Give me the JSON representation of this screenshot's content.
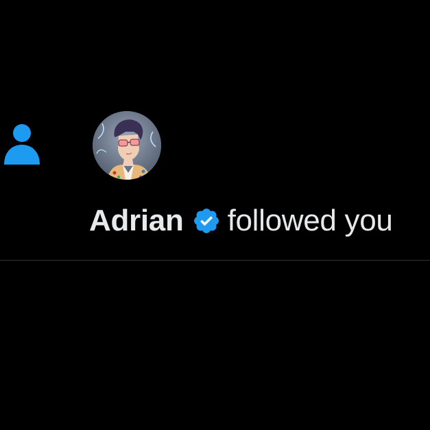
{
  "notification": {
    "type_icon": "person-follow-icon",
    "avatar_icon": "user-avatar-image",
    "verified_icon": "verified-badge-icon",
    "user_name": "Adrian",
    "action_text": "followed you",
    "colors": {
      "background": "#000000",
      "accent": "#1d9bf0",
      "text": "#e7e9ea",
      "divider": "#2f3336"
    }
  }
}
